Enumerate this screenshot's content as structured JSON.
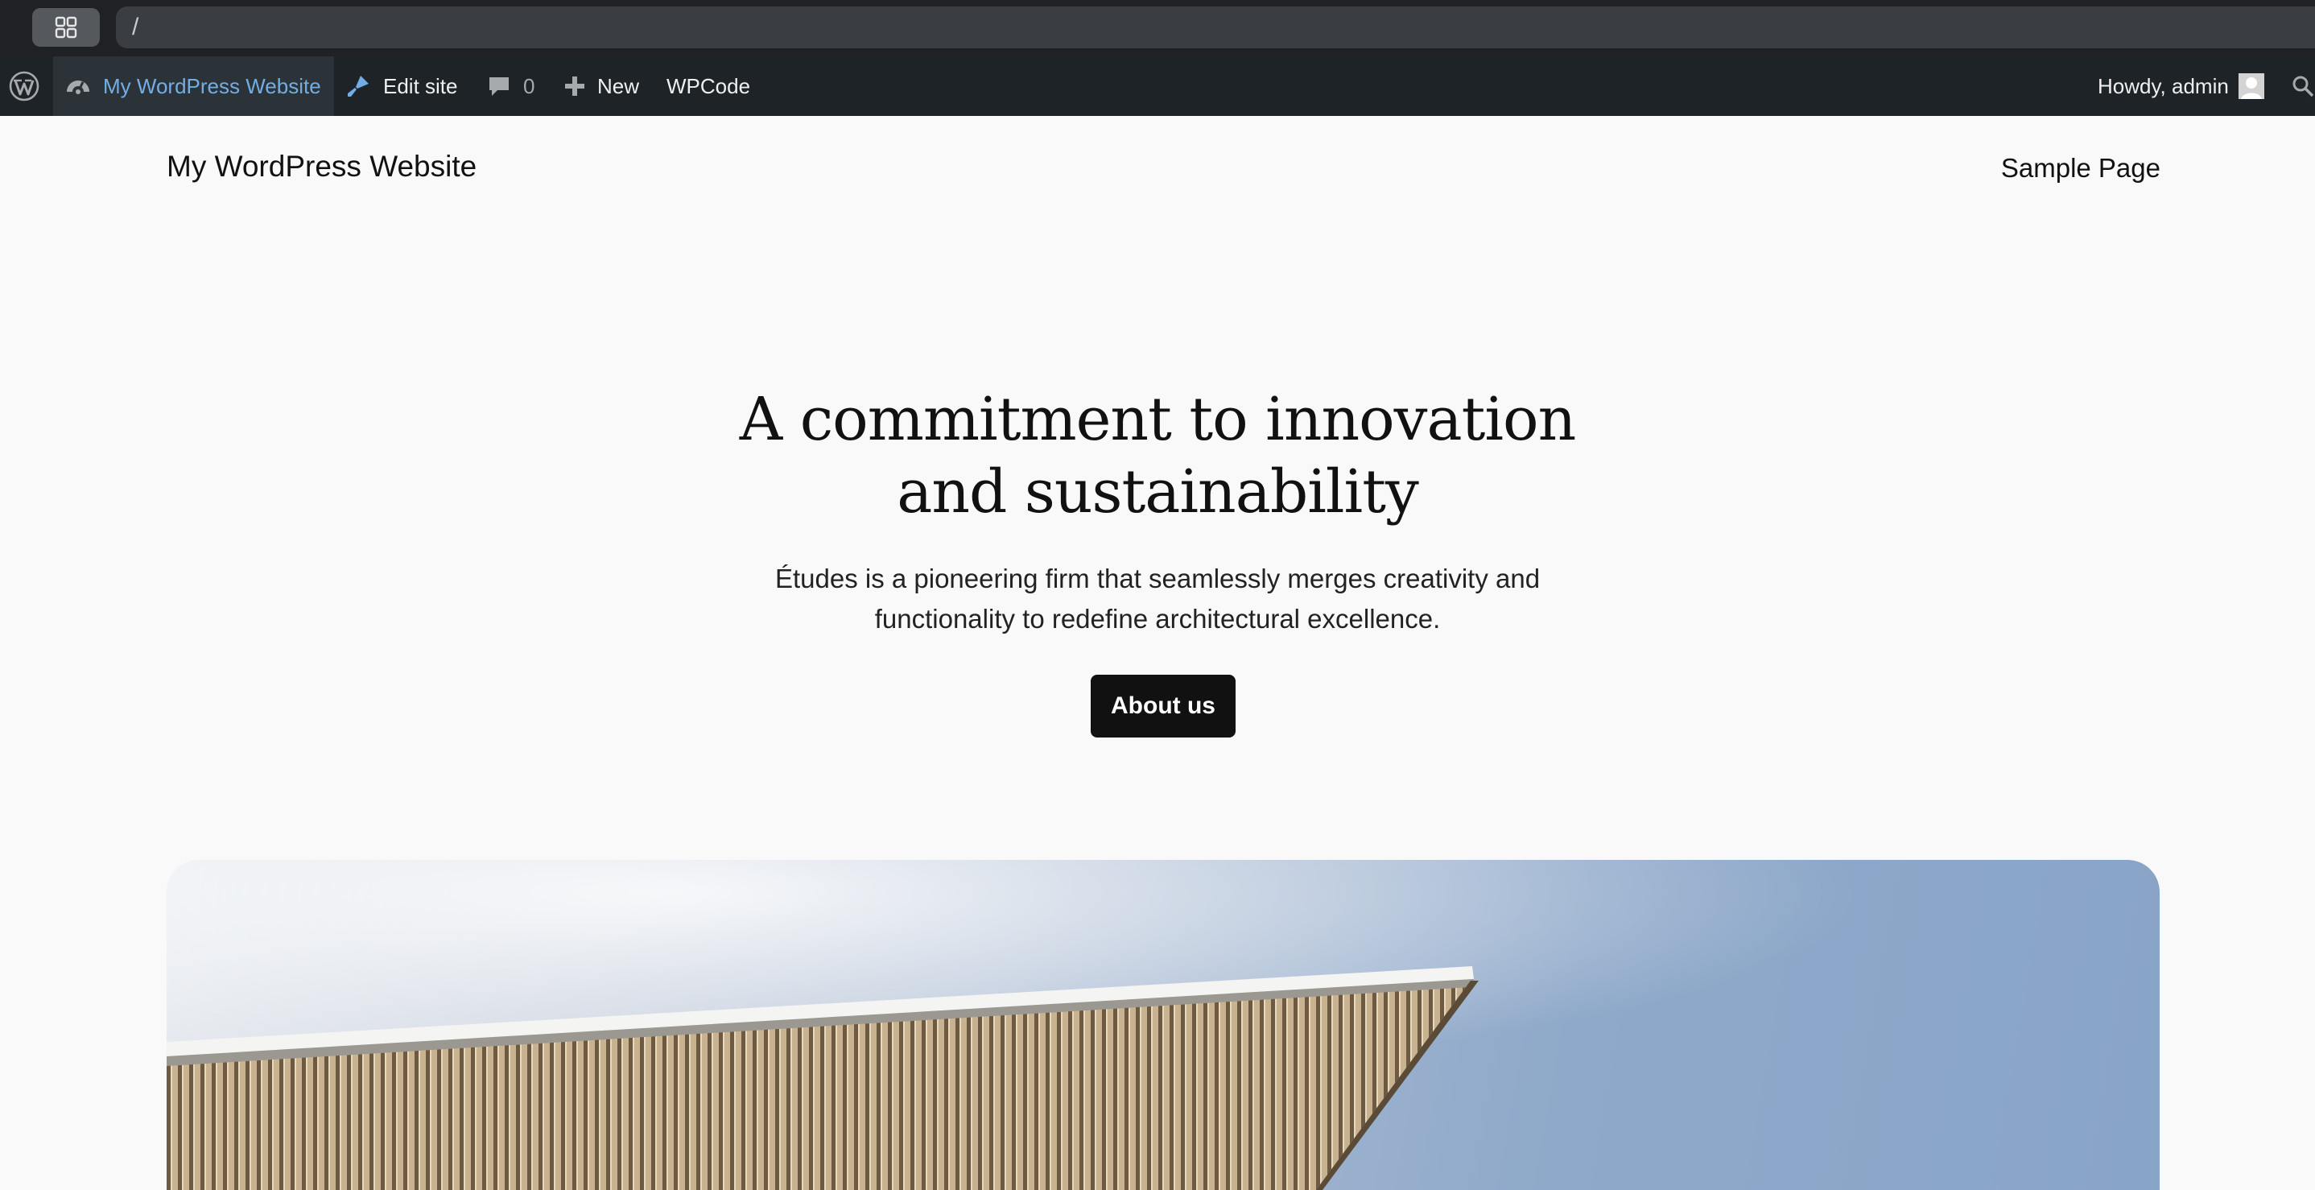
{
  "browser": {
    "url": "/"
  },
  "admin_bar": {
    "site_name": "My WordPress Website",
    "edit_site": "Edit site",
    "comments_count": "0",
    "new_label": "New",
    "wpcode_label": "WPCode",
    "howdy": "Howdy, admin",
    "icons": {
      "wp": "wordpress-logo-icon",
      "site": "dashboard-gauge-icon",
      "edit": "brush-icon",
      "comments": "comment-bubble-icon",
      "new": "plus-icon",
      "search": "search-icon"
    }
  },
  "site": {
    "title": "My WordPress Website",
    "nav_link": "Sample Page"
  },
  "hero": {
    "heading_line1": "A commitment to innovation",
    "heading_line2": "and sustainability",
    "text_line1": "Études is a pioneering firm that seamlessly merges creativity and",
    "text_line2": "functionality to redefine architectural excellence.",
    "button_label": "About us"
  },
  "colors": {
    "admin_bar_bg": "#1d2327",
    "admin_link_active": "#72aee6",
    "page_bg": "#f9f9f9",
    "button_bg": "#111111"
  }
}
